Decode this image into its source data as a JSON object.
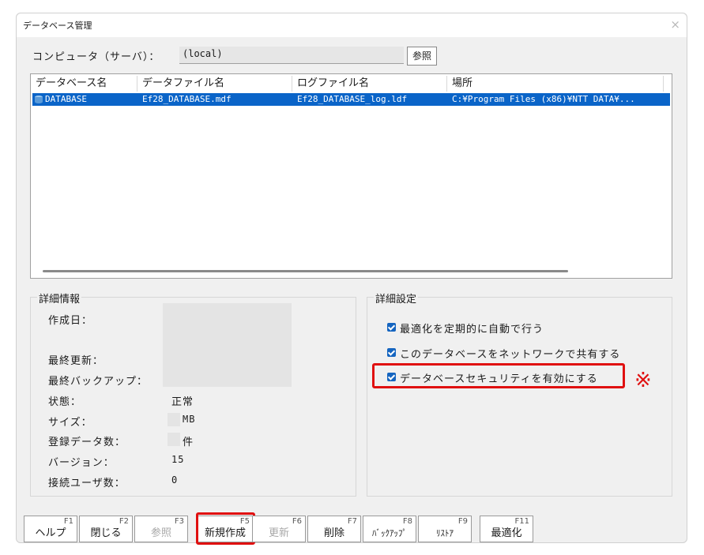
{
  "window": {
    "title": "データベース管理",
    "close_glyph": "×"
  },
  "computer": {
    "label": "コンピュータ（サーバ）：",
    "value": "(local)",
    "browse_label": "参照"
  },
  "list": {
    "columns": [
      "データベース名",
      "データファイル名",
      "ログファイル名",
      "場所"
    ],
    "rows": [
      {
        "name": "DATABASE",
        "data_file": "Ef28_DATABASE.mdf",
        "log_file": "Ef28_DATABASE_log.ldf",
        "location": "C:¥Program Files (x86)¥NTT DATA¥..."
      }
    ],
    "row_icon": "database-icon"
  },
  "details": {
    "title": "詳細情報",
    "created_label": "作成日：",
    "last_updated_label": "最終更新：",
    "last_backup_label": "最終バックアップ：",
    "status_label": "状態：",
    "status_value": "正常",
    "size_label": "サイズ：",
    "size_unit": "MB",
    "records_label": "登録データ数：",
    "records_unit": "件",
    "version_label": "バージョン：",
    "version_value": "15",
    "users_label": "接続ユーザ数：",
    "users_value": "0"
  },
  "settings": {
    "title": "詳細設定",
    "options": [
      {
        "label": "最適化を定期的に自動で行う",
        "checked": true
      },
      {
        "label": "このデータベースをネットワークで共有する",
        "checked": true
      },
      {
        "label": "データベースセキュリティを有効にする",
        "checked": true
      }
    ],
    "note_mark": "※"
  },
  "fkeys": [
    {
      "key": "F1",
      "label": "ヘルプ",
      "enabled": true
    },
    {
      "key": "F2",
      "label": "閉じる",
      "enabled": true
    },
    {
      "key": "F3",
      "label": "参照",
      "enabled": false
    },
    {
      "key": "F5",
      "label": "新規作成",
      "enabled": true
    },
    {
      "key": "F6",
      "label": "更新",
      "enabled": false
    },
    {
      "key": "F7",
      "label": "削除",
      "enabled": true
    },
    {
      "key": "F8",
      "label": "ﾊﾞｯｸｱｯﾌﾟ",
      "enabled": true
    },
    {
      "key": "F9",
      "label": "ﾘｽﾄｱ",
      "enabled": true
    },
    {
      "key": "F11",
      "label": "最適化",
      "enabled": true
    }
  ],
  "colors": {
    "selection": "#0a64c8",
    "highlight": "#e01010",
    "checkbox": "#1565c0"
  }
}
